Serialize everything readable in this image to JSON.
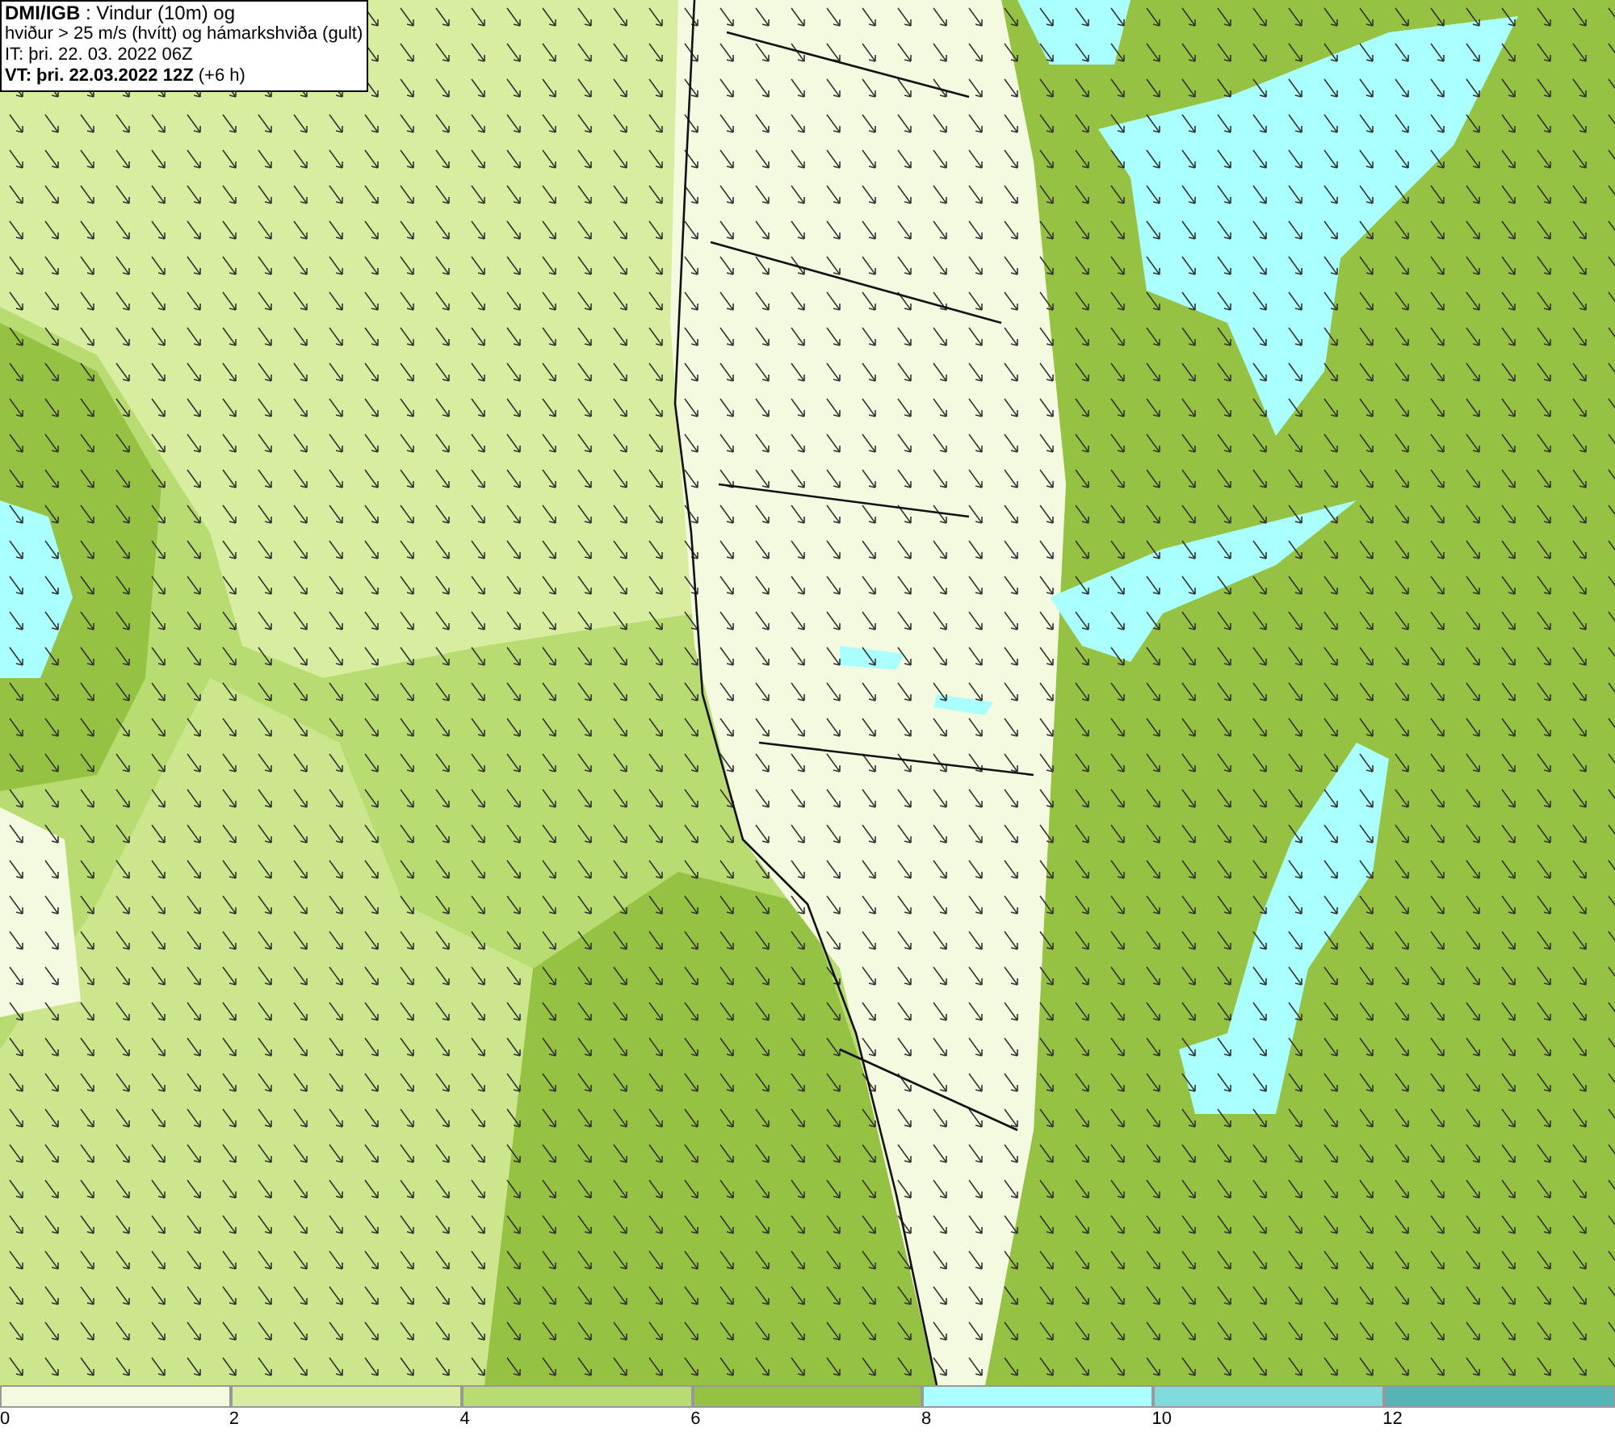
{
  "header": {
    "lines": [
      "**DMI/IGB** : Vindur (10m) og",
      "hviður > 25 m/s (hvítt) og hámarkshviða (gult)",
      "IT: þri. 22. 03. 2022 06Z",
      "**VT: þri. 22.03.2022 12Z** (+6 h)"
    ]
  },
  "legend": [
    {
      "color": "#f4fadf",
      "label": "0"
    },
    {
      "color": "#d8eda0",
      "label": "2"
    },
    {
      "color": "#b8dc72",
      "label": "4"
    },
    {
      "color": "#96c244",
      "label": "6"
    },
    {
      "color": "#aaffff",
      "label": "8"
    },
    {
      "color": "#80dcdc",
      "label": "10"
    },
    {
      "color": "#55b4b4",
      "label": "12"
    }
  ]
}
